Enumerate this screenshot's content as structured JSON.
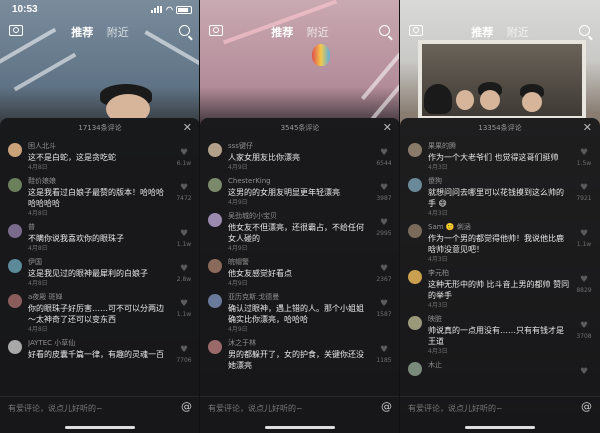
{
  "panels": [
    {
      "status_time": "10:53",
      "nav": {
        "left": "推荐",
        "right": "附近"
      },
      "comment_count": "17134条评论",
      "input_placeholder": "有爱评论，说点儿好听的~",
      "comments": [
        {
          "user": "困人北斗",
          "text": "这不是白蛇，这是贪吃蛇",
          "date": "4月8日",
          "likes": "6.1w",
          "color": "#c9a27a"
        },
        {
          "user": "鞋价娘娘",
          "text": "这是我看过白娘子最赞的版本！哈哈哈哈哈哈哈",
          "date": "4月8日",
          "likes": "7472",
          "color": "#6b7f5a"
        },
        {
          "user": "普",
          "text": "不瞒你说我喜欢你的眼珠子",
          "date": "4月8日",
          "likes": "1.1w",
          "color": "#7a6a8c"
        },
        {
          "user": "伊国",
          "text": "这是我见过的眼神最犀利的白娘子",
          "date": "4月8日",
          "likes": "2.8w",
          "color": "#5c8a9a"
        },
        {
          "user": "a夜殿 斑婵",
          "text": "你的眼珠子好厉害……可不可以分两边～太神奇了还可以变东西",
          "date": "4月8日",
          "likes": "1.1w",
          "color": "#8a5c5c"
        },
        {
          "user": "JAYTEC 小草仙",
          "text": "好看的皮囊千篇一律，有趣的灵魂一百",
          "date": "",
          "likes": "7706",
          "color": "#a8a8a8"
        }
      ]
    },
    {
      "status_time": "",
      "nav": {
        "left": "推荐",
        "right": "附近"
      },
      "comment_count": "3545条评论",
      "input_placeholder": "有爱评论，说点儿好听的~",
      "comments": [
        {
          "user": "sss键仔",
          "text": "人家女朋友比你漂亮",
          "date": "4月9日",
          "likes": "6544",
          "color": "#b3a08a"
        },
        {
          "user": "ChesterKing",
          "text": "这男的的女朋友明显更年轻漂亮",
          "date": "4月9日",
          "likes": "3987",
          "color": "#7a8a6a"
        },
        {
          "user": "吴劲城的小宝贝",
          "text": "他女友不但漂亮，还很霸占，不给任何女人碰的",
          "date": "4月9日",
          "likes": "2995",
          "color": "#9a8ab0"
        },
        {
          "user": "皖帽警",
          "text": "他女友感觉好看点",
          "date": "4月9日",
          "likes": "2367",
          "color": "#8a6a5a"
        },
        {
          "user": "亚历克斯.戈德曼",
          "text": "确认过眼神，遇上错的人。那个小姐姐确实比你漂亮，哈哈哈",
          "date": "4月9日",
          "likes": "1587",
          "color": "#6a7a9a"
        },
        {
          "user": "沐之于林",
          "text": "男的都躲开了，女的护食，关键你还没她漂亮",
          "date": "",
          "likes": "1185",
          "color": "#9a6a6a"
        }
      ]
    },
    {
      "status_time": "",
      "nav": {
        "left": "推荐",
        "right": "附近"
      },
      "comment_count": "13354条评论",
      "input_placeholder": "有爱评论，说点儿好听的~",
      "comments": [
        {
          "user": "果果的腾",
          "text": "作为一个大老爷们 也觉得这哥们挺帅",
          "date": "4月3日",
          "likes": "1.5w",
          "color": "#8a7a6a"
        },
        {
          "user": "傻狗",
          "text": "就想问问去哪里可以花钱摸到这么帅的手 😄",
          "date": "4月3日",
          "likes": "7921",
          "color": "#6a8a9a"
        },
        {
          "user": "Sam 🙂 俐涵",
          "text": "作为一个男的都觉得他帅！我说他比鹿晗帅没意见吧！",
          "date": "4月3日",
          "likes": "1.1w",
          "color": "#7a6a5a"
        },
        {
          "user": "李元柏",
          "text": "这种无形中的帅 比斗音上男的都帅 赞同的举手",
          "date": "4月3日",
          "likes": "8829",
          "color": "#c9a050"
        },
        {
          "user": "映脏",
          "text": "帅说真的一点用没有……只有有钱才是王道",
          "date": "4月3日",
          "likes": "3708",
          "color": "#9a9a7a"
        },
        {
          "user": "木止",
          "text": "",
          "date": "",
          "likes": "",
          "color": "#7a8a7a"
        }
      ]
    }
  ]
}
